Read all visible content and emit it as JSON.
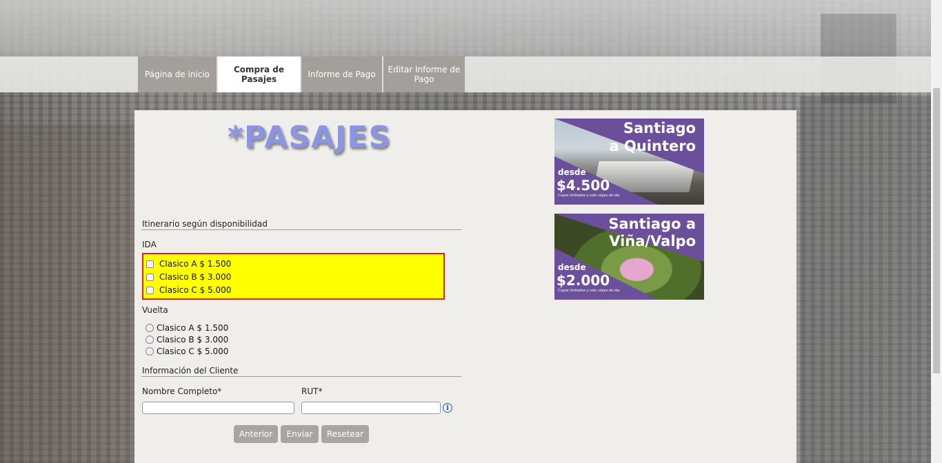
{
  "nav": {
    "items": [
      {
        "label": "Página de inicio"
      },
      {
        "label": "Compra de Pasajes"
      },
      {
        "label": "Informe de Pago"
      },
      {
        "label": "Editar Informe de Pago"
      }
    ],
    "active": "Compra de Pasajes"
  },
  "page": {
    "title": "*PASAJES",
    "title_color": "#8c96e0"
  },
  "itinerary": {
    "heading": "Itinerario según disponibilidad",
    "ida_label": "IDA",
    "ida_options": [
      {
        "label": "Clasico A $ 1.500",
        "checked": false
      },
      {
        "label": "Clasico B $ 3.000",
        "checked": false
      },
      {
        "label": "Clasico C $ 5.000",
        "checked": false
      }
    ],
    "ida_highlight_color": "#ffff00",
    "ida_border_color": "#dd2222",
    "vuelta_label": "Vuelta",
    "vuelta_options": [
      {
        "label": "Clasico A $ 1.500",
        "selected": false
      },
      {
        "label": "Clasico B $ 3.000",
        "selected": false
      },
      {
        "label": "Clasico C $ 5.000",
        "selected": false
      }
    ]
  },
  "client": {
    "heading": "Información del Cliente",
    "name_label": "Nombre Completo*",
    "name_value": "",
    "rut_label": "RUT*",
    "rut_value": "",
    "info_icon": "info-icon"
  },
  "buttons": {
    "prev": "Anterior",
    "send": "Enviar",
    "reset": "Resetear"
  },
  "banners": [
    {
      "title_line1": "Santiago",
      "title_line2": "a Quintero",
      "desde": "desde",
      "price": "$4.500",
      "fine_print": "Cupos limitados y solo viajes de ida",
      "accent": "#6b4f9a"
    },
    {
      "title_line1": "Santiago a",
      "title_line2": "Viña/Valpo",
      "desde": "desde",
      "price": "$2.000",
      "fine_print": "Cupos limitados y solo viajes de ida",
      "accent": "#6b4f9a"
    }
  ]
}
